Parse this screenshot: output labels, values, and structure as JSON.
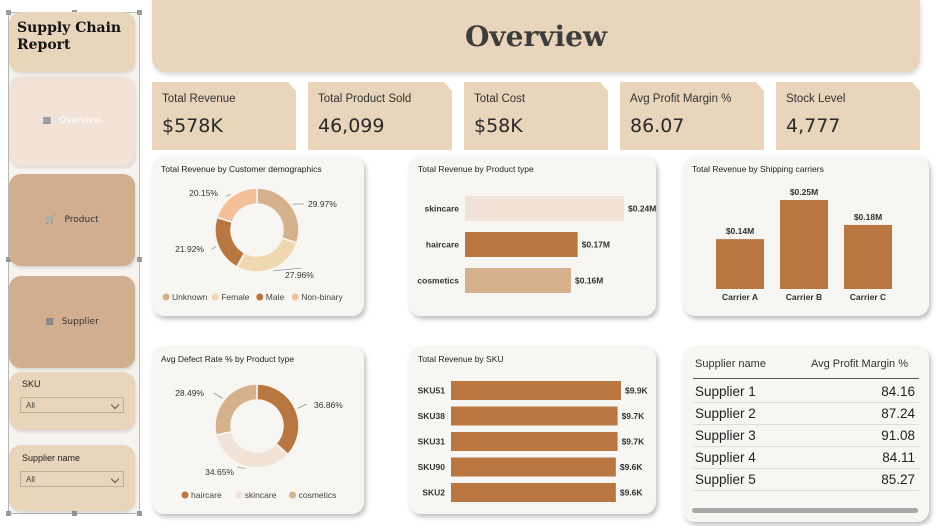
{
  "app": {
    "title": "Supply Chain Report"
  },
  "header": {
    "title": "Overview"
  },
  "nav": [
    {
      "label": "Overview",
      "icon": "overview-icon"
    },
    {
      "label": "Product",
      "icon": "cart-icon"
    },
    {
      "label": "Supplier",
      "icon": "supplier-icon"
    }
  ],
  "slicers": [
    {
      "title": "SKU",
      "value": "All"
    },
    {
      "title": "Supplier name",
      "value": "All"
    }
  ],
  "kpis": [
    {
      "label": "Total Revenue",
      "value": "$578K"
    },
    {
      "label": "Total Product Sold",
      "value": "46,099"
    },
    {
      "label": "Total Cost",
      "value": "$58K"
    },
    {
      "label": "Avg Profit Margin %",
      "value": "86.07"
    },
    {
      "label": "Stock Level",
      "value": "4,777"
    }
  ],
  "colors": {
    "beige": "#e8d5bb",
    "brown": "#b87640",
    "tan": "#d6b18d",
    "light": "#f3e3d6",
    "peach": "#f4c09a"
  },
  "chart_data": [
    {
      "type": "pie",
      "title": "Total Revenue by Customer demographics",
      "categories": [
        "Unknown",
        "Female",
        "Male",
        "Non-binary"
      ],
      "values": [
        29.97,
        27.96,
        21.92,
        20.15
      ],
      "labels": [
        "29.97%",
        "27.96%",
        "21.92%",
        "20.15%"
      ],
      "colors": [
        "#d6b18d",
        "#efd8b0",
        "#b87640",
        "#f4c09a"
      ],
      "legend": "bottom"
    },
    {
      "type": "bar",
      "orientation": "horizontal",
      "title": "Total Revenue by Product type",
      "categories": [
        "skincare",
        "haircare",
        "cosmetics"
      ],
      "values": [
        0.24,
        0.17,
        0.16
      ],
      "labels": [
        "$0.24M",
        "$0.17M",
        "$0.16M"
      ],
      "colors": [
        "#f3e3d6",
        "#b87640",
        "#d6b18d"
      ]
    },
    {
      "type": "bar",
      "title": "Total Revenue by Shipping carriers",
      "categories": [
        "Carrier A",
        "Carrier B",
        "Carrier C"
      ],
      "values": [
        0.14,
        0.25,
        0.18
      ],
      "labels": [
        "$0.14M",
        "$0.25M",
        "$0.18M"
      ]
    },
    {
      "type": "pie",
      "title": "Avg Defect Rate % by Product type",
      "categories": [
        "haircare",
        "skincare",
        "cosmetics"
      ],
      "values": [
        36.86,
        34.65,
        28.49
      ],
      "labels": [
        "36.86%",
        "34.65%",
        "28.49%"
      ],
      "colors": [
        "#b87640",
        "#f3e3d6",
        "#d6b18d"
      ],
      "legend": "bottom"
    },
    {
      "type": "bar",
      "orientation": "horizontal",
      "title": "Total Revenue by SKU",
      "categories": [
        "SKU51",
        "SKU38",
        "SKU31",
        "SKU90",
        "SKU2"
      ],
      "values": [
        9.9,
        9.7,
        9.7,
        9.6,
        9.6
      ],
      "labels": [
        "$9.9K",
        "$9.7K",
        "$9.7K",
        "$9.6K",
        "$9.6K"
      ]
    }
  ],
  "table": {
    "headers": [
      "Supplier name",
      "Avg Profit Margin %"
    ],
    "rows": [
      [
        "Supplier 1",
        "84.16"
      ],
      [
        "Supplier 2",
        "87.24"
      ],
      [
        "Supplier 3",
        "91.08"
      ],
      [
        "Supplier 4",
        "84.11"
      ],
      [
        "Supplier 5",
        "85.27"
      ]
    ]
  }
}
